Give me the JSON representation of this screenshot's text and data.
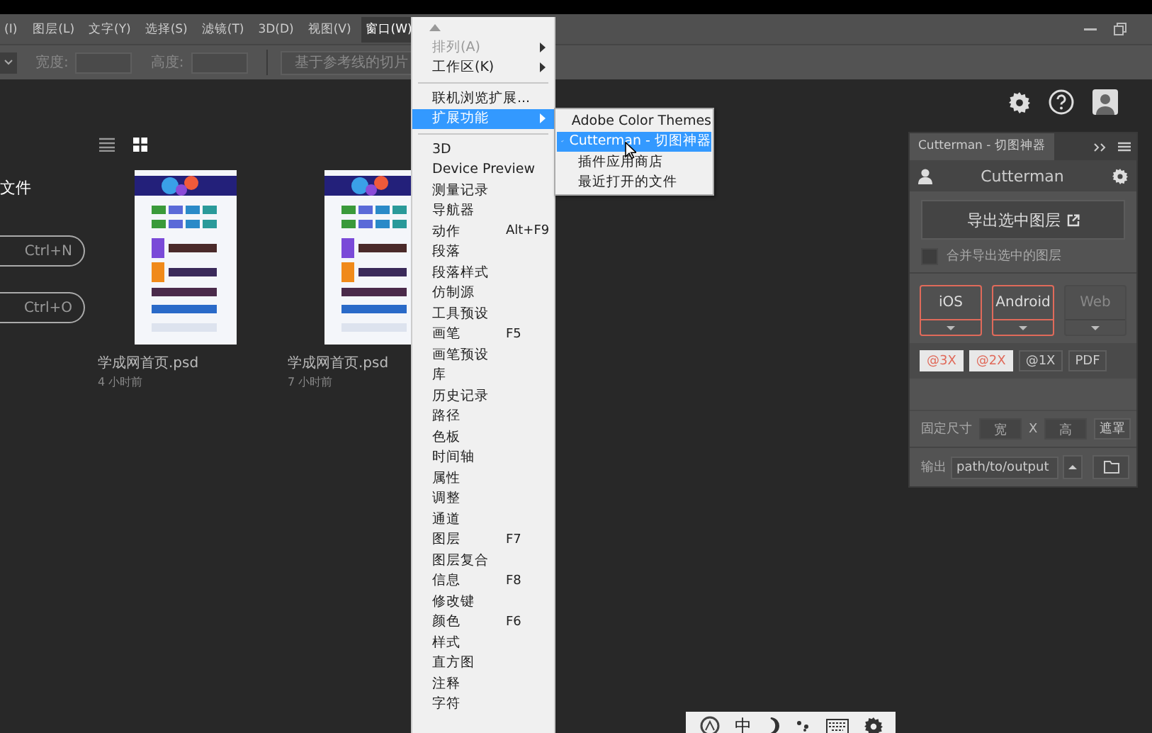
{
  "menubar": [
    {
      "label": "(I)",
      "selected": false
    },
    {
      "label": "图层(L)",
      "selected": false
    },
    {
      "label": "文字(Y)",
      "selected": false
    },
    {
      "label": "选择(S)",
      "selected": false
    },
    {
      "label": "滤镜(T)",
      "selected": false
    },
    {
      "label": "3D(D)",
      "selected": false
    },
    {
      "label": "视图(V)",
      "selected": false
    },
    {
      "label": "窗口(W)",
      "selected": true
    }
  ],
  "options_bar": {
    "width_label": "宽度:",
    "height_label": "高度:",
    "slice_button": "基于参考线的切片"
  },
  "home": {
    "heading": "文件",
    "buttons": [
      {
        "shortcut": "Ctrl+N"
      },
      {
        "shortcut": "Ctrl+O"
      }
    ],
    "view_toggle": [
      {
        "kind": "list",
        "selected": false
      },
      {
        "kind": "grid",
        "selected": true
      }
    ],
    "recent_files": [
      {
        "name": "学成网首页.psd",
        "time": "4 小时前"
      },
      {
        "name": "学成网首页.psd",
        "time": "7 小时前"
      }
    ]
  },
  "window_menu": [
    {
      "kind": "scroll-up"
    },
    {
      "kind": "item",
      "label": "排列(A)",
      "submenu": true,
      "disabled": true,
      "selected": false
    },
    {
      "kind": "item",
      "label": "工作区(K)",
      "submenu": true,
      "disabled": false,
      "selected": false
    },
    {
      "kind": "separator"
    },
    {
      "kind": "item",
      "label": "联机浏览扩展...",
      "submenu": false,
      "disabled": false,
      "selected": false
    },
    {
      "kind": "item",
      "label": "扩展功能",
      "submenu": true,
      "disabled": false,
      "selected": true
    },
    {
      "kind": "separator"
    },
    {
      "kind": "item",
      "label": "3D",
      "submenu": false,
      "disabled": false,
      "selected": false
    },
    {
      "kind": "item",
      "label": "Device Preview",
      "submenu": false,
      "disabled": false,
      "selected": false
    },
    {
      "kind": "item",
      "label": "测量记录",
      "submenu": false,
      "disabled": false,
      "selected": false
    },
    {
      "kind": "item",
      "label": "导航器",
      "submenu": false,
      "disabled": false,
      "selected": false
    },
    {
      "kind": "item",
      "label": "动作",
      "shortcut": "Alt+F9",
      "submenu": false,
      "disabled": false,
      "selected": false
    },
    {
      "kind": "item",
      "label": "段落",
      "submenu": false,
      "disabled": false,
      "selected": false
    },
    {
      "kind": "item",
      "label": "段落样式",
      "submenu": false,
      "disabled": false,
      "selected": false
    },
    {
      "kind": "item",
      "label": "仿制源",
      "submenu": false,
      "disabled": false,
      "selected": false
    },
    {
      "kind": "item",
      "label": "工具预设",
      "submenu": false,
      "disabled": false,
      "selected": false
    },
    {
      "kind": "item",
      "label": "画笔",
      "shortcut": "F5",
      "submenu": false,
      "disabled": false,
      "selected": false
    },
    {
      "kind": "item",
      "label": "画笔预设",
      "submenu": false,
      "disabled": false,
      "selected": false
    },
    {
      "kind": "item",
      "label": "库",
      "submenu": false,
      "disabled": false,
      "selected": false
    },
    {
      "kind": "item",
      "label": "历史记录",
      "submenu": false,
      "disabled": false,
      "selected": false
    },
    {
      "kind": "item",
      "label": "路径",
      "submenu": false,
      "disabled": false,
      "selected": false
    },
    {
      "kind": "item",
      "label": "色板",
      "submenu": false,
      "disabled": false,
      "selected": false
    },
    {
      "kind": "item",
      "label": "时间轴",
      "submenu": false,
      "disabled": false,
      "selected": false
    },
    {
      "kind": "item",
      "label": "属性",
      "submenu": false,
      "disabled": false,
      "selected": false
    },
    {
      "kind": "item",
      "label": "调整",
      "submenu": false,
      "disabled": false,
      "selected": false
    },
    {
      "kind": "item",
      "label": "通道",
      "submenu": false,
      "disabled": false,
      "selected": false
    },
    {
      "kind": "item",
      "label": "图层",
      "shortcut": "F7",
      "submenu": false,
      "disabled": false,
      "selected": false
    },
    {
      "kind": "item",
      "label": "图层复合",
      "submenu": false,
      "disabled": false,
      "selected": false
    },
    {
      "kind": "item",
      "label": "信息",
      "shortcut": "F8",
      "submenu": false,
      "disabled": false,
      "selected": false
    },
    {
      "kind": "item",
      "label": "修改键",
      "submenu": false,
      "disabled": false,
      "selected": false
    },
    {
      "kind": "item",
      "label": "颜色",
      "shortcut": "F6",
      "submenu": false,
      "disabled": false,
      "selected": false
    },
    {
      "kind": "item",
      "label": "样式",
      "submenu": false,
      "disabled": false,
      "selected": false
    },
    {
      "kind": "item",
      "label": "直方图",
      "submenu": false,
      "disabled": false,
      "selected": false
    },
    {
      "kind": "item",
      "label": "注释",
      "submenu": false,
      "disabled": false,
      "selected": false
    },
    {
      "kind": "item",
      "label": "字符",
      "submenu": false,
      "disabled": false,
      "selected": false
    }
  ],
  "extensions_submenu": [
    {
      "label": "Adobe Color Themes",
      "checked": false,
      "selected": false
    },
    {
      "label": "Cutterman - 切图神器",
      "checked": true,
      "selected": true
    },
    {
      "label": "插件应用商店",
      "checked": false,
      "selected": false
    },
    {
      "label": "最近打开的文件",
      "checked": false,
      "selected": false
    }
  ],
  "cutterman_panel": {
    "tab": "Cutterman - 切图神器",
    "title": "Cutterman",
    "export_button": "导出选中图层",
    "merge_checkbox": {
      "label": "合并导出选中的图层",
      "checked": false
    },
    "platforms": [
      {
        "label": "iOS",
        "selected": true
      },
      {
        "label": "Android",
        "selected": true
      },
      {
        "label": "Web",
        "selected": false
      }
    ],
    "scales": [
      {
        "label": "@3X",
        "selected": true
      },
      {
        "label": "@2X",
        "selected": true
      },
      {
        "label": "@1X",
        "selected": false
      },
      {
        "label": "PDF",
        "selected": false
      }
    ],
    "fixed_size": {
      "label": "固定尺寸",
      "width_placeholder": "宽",
      "separator": "X",
      "height_placeholder": "高",
      "mask_button": "遮罩"
    },
    "output": {
      "label": "输出",
      "path": "path/to/output"
    }
  },
  "ime_bar": {
    "mode": "中"
  }
}
